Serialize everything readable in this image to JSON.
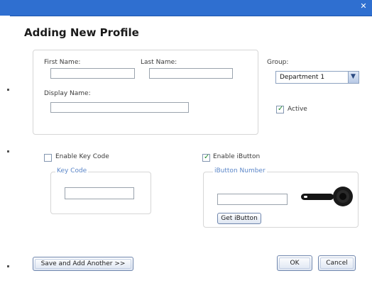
{
  "window": {
    "close_icon": "close-icon",
    "title": "Adding New Profile"
  },
  "profile": {
    "first_name_label": "First Name:",
    "first_name_value": "",
    "last_name_label": "Last Name:",
    "last_name_value": "",
    "display_name_label": "Display Name:",
    "display_name_value": ""
  },
  "group": {
    "label": "Group:",
    "selected": "Department 1",
    "options": [
      "Department 1"
    ],
    "arrow_icon": "chevron-down-icon"
  },
  "active": {
    "label": "Active",
    "checked": true
  },
  "key_code": {
    "enable_label": "Enable Key Code",
    "checked": false,
    "legend": "Key Code",
    "value": ""
  },
  "ibutton": {
    "enable_label": "Enable iButton",
    "checked": true,
    "legend": "iButton Number",
    "value": "",
    "get_button_label": "Get iButton",
    "key_icon": "ibutton-key-icon"
  },
  "footer": {
    "save_add_label": "Save and Add Another >>",
    "ok_label": "OK",
    "cancel_label": "Cancel"
  },
  "colors": {
    "titlebar": "#2f6fd0",
    "check": "#1f8a2a",
    "legend": "#5b86c8"
  }
}
